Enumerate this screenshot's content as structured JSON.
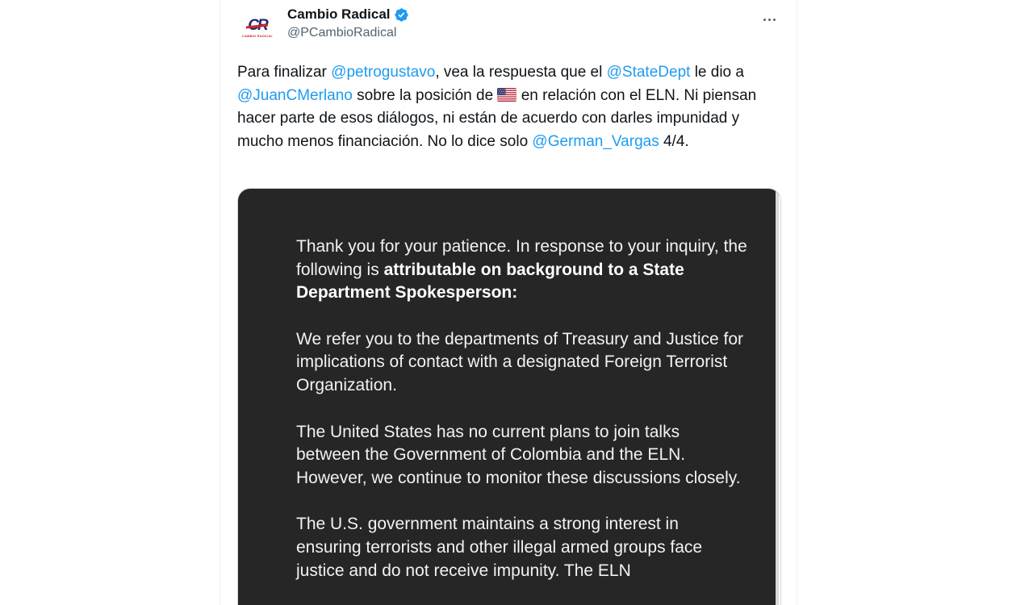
{
  "account": {
    "display_name": "Cambio Radical",
    "handle": "@PCambioRadical",
    "avatar_mark": "CR",
    "avatar_sub": "CAMBIO RADICAL",
    "verified_color": "#1d9bf0"
  },
  "tweet": {
    "segments": [
      {
        "text": "Para finalizar ",
        "type": "text"
      },
      {
        "text": "@petrogustavo",
        "type": "mention"
      },
      {
        "text": ", vea la respuesta que el ",
        "type": "text"
      },
      {
        "text": "@StateDept",
        "type": "mention"
      },
      {
        "text": " le dio a ",
        "type": "text"
      },
      {
        "text": "@JuanCMerlano",
        "type": "mention"
      },
      {
        "text": " sobre la posición de ",
        "type": "text"
      },
      {
        "text": "us-flag-icon",
        "type": "icon"
      },
      {
        "text": " en relación con el ELN. Ni piensan hacer parte de esos diálogos, ni están de  acuerdo con darles impunidad y mucho menos financiación. No lo dice solo ",
        "type": "text"
      },
      {
        "text": "@German_Vargas",
        "type": "mention"
      },
      {
        "text": " 4/4.",
        "type": "text"
      }
    ]
  },
  "statement": {
    "p1_a": "Thank you for your patience. In response to your inquiry, the following is ",
    "p1_b": "attributable on background to a State Department Spokesperson:",
    "p2": "We refer you to the departments of Treasury and Justice for implications of contact with a designated Foreign Terrorist Organization.",
    "p3": "The United States has no current plans to join talks between the Government of Colombia and the ELN.  However, we continue to monitor these discussions closely.",
    "p4": "The U.S. government maintains a strong interest in ensuring terrorists and other illegal armed groups face justice and do not receive impunity.  The ELN"
  },
  "colors": {
    "mention": "#1d9bf0",
    "text": "#0f1419",
    "secondary": "#536471",
    "media_bg": "#262626"
  }
}
